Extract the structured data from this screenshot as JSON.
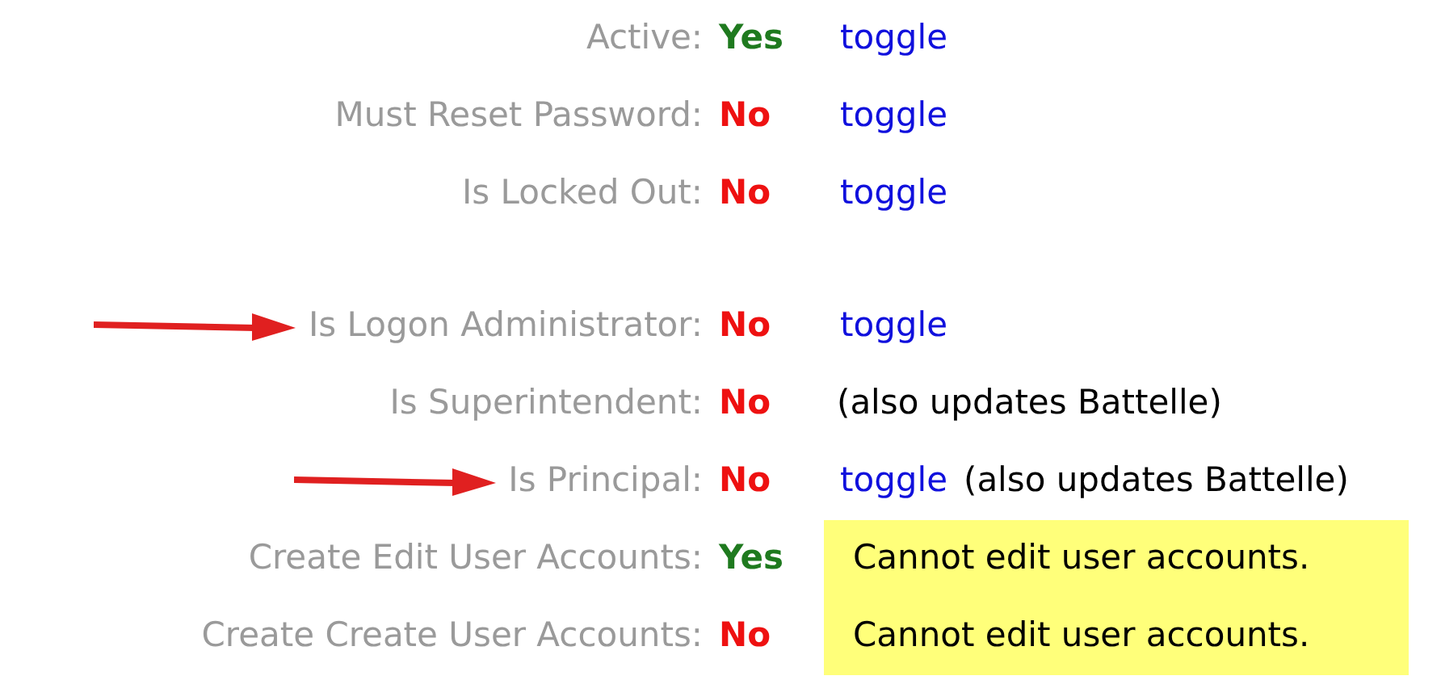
{
  "sections": [
    {
      "rows": [
        {
          "label": "Active:",
          "value": {
            "text": "Yes",
            "kind": "yes"
          },
          "actions": [
            {
              "kind": "link",
              "text": "toggle"
            }
          ],
          "arrow": false
        },
        {
          "label": "Must Reset Password:",
          "value": {
            "text": "No",
            "kind": "no"
          },
          "actions": [
            {
              "kind": "link",
              "text": "toggle"
            }
          ],
          "arrow": false
        },
        {
          "label": "Is Locked Out:",
          "value": {
            "text": "No",
            "kind": "no"
          },
          "actions": [
            {
              "kind": "link",
              "text": "toggle"
            }
          ],
          "arrow": false
        }
      ]
    },
    {
      "rows": [
        {
          "label": "Is Logon Administrator:",
          "value": {
            "text": "No",
            "kind": "no"
          },
          "actions": [
            {
              "kind": "link",
              "text": "toggle"
            }
          ],
          "arrow": true
        },
        {
          "label": "Is Superintendent:",
          "value": {
            "text": "No",
            "kind": "no"
          },
          "actions": [
            {
              "kind": "text",
              "text": "(also updates Battelle)"
            }
          ],
          "arrow": false
        },
        {
          "label": "Is Principal:",
          "value": {
            "text": "No",
            "kind": "no"
          },
          "actions": [
            {
              "kind": "link",
              "text": "toggle"
            },
            {
              "kind": "text",
              "text": "(also updates Battelle)"
            }
          ],
          "arrow": true
        },
        {
          "label": "Create Edit User Accounts:",
          "value": {
            "text": "Yes",
            "kind": "yes"
          },
          "actions": [
            {
              "kind": "note",
              "text": "Cannot edit user accounts."
            }
          ],
          "arrow": false
        },
        {
          "label": "Create Create User Accounts:",
          "value": {
            "text": "No",
            "kind": "no"
          },
          "actions": [
            {
              "kind": "note",
              "text": "Cannot edit user accounts."
            }
          ],
          "arrow": false
        }
      ]
    }
  ]
}
